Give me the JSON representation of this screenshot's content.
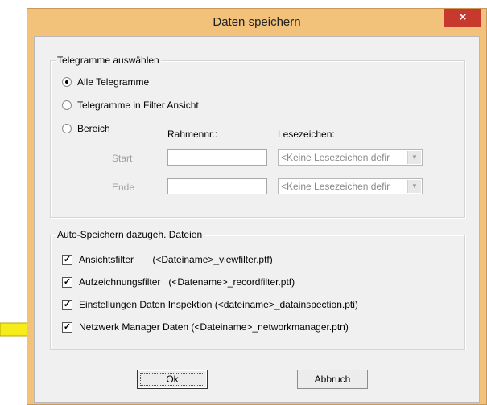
{
  "window": {
    "title": "Daten speichern",
    "close_glyph": "×"
  },
  "group_telegrams": {
    "legend": "Telegramme auswählen",
    "radios": [
      {
        "label": "Alle Telegramme",
        "selected": true
      },
      {
        "label": "Telegramme in Filter Ansicht",
        "selected": false
      },
      {
        "label": "Bereich",
        "selected": false
      }
    ],
    "col_frame": "Rahmennr.:",
    "col_bookmark": "Lesezeichen:",
    "start_label": "Start",
    "end_label": "Ende",
    "start_value": "",
    "end_value": "",
    "bookmark_placeholder_start": "<Keine Lesezeichen defir",
    "bookmark_placeholder_end": "<Keine Lesezeichen defir"
  },
  "group_autosave": {
    "legend": "Auto-Speichern dazugeh. Dateien",
    "items": [
      {
        "label": "Ansichtsfilter       (<Dateiname>_viewfilter.ptf)",
        "checked": true
      },
      {
        "label": "Aufzeichnungsfilter   (<Datename>_recordfilter.ptf)",
        "checked": true
      },
      {
        "label": "Einstellungen Daten Inspektion (<dateiname>_datainspection.pti)",
        "checked": true
      },
      {
        "label": "Netzwerk Manager Daten (<Dateiname>_networkmanager.ptn)",
        "checked": true
      }
    ]
  },
  "buttons": {
    "ok": "Ok",
    "cancel": "Abbruch"
  },
  "colors": {
    "frame": "#f2c17a",
    "close": "#c7382d",
    "pointer_arrow": "#f5ec1a"
  }
}
